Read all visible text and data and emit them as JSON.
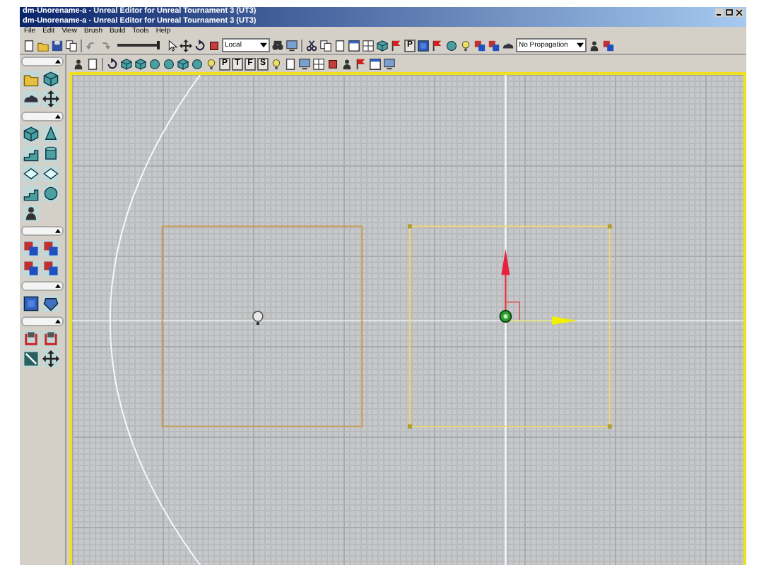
{
  "window": {
    "title": "dm-Unorename-a - Unreal Editor for Unreal Tournament 3 (UT3)",
    "subtitle": "dm-Unorename-a - Unreal Editor for Unreal Tournament 3 (UT3)"
  },
  "menu": [
    "File",
    "Edit",
    "View",
    "Brush",
    "Build",
    "Tools",
    "Help"
  ],
  "toolbar": {
    "slider": {
      "level": 0.95
    },
    "coordinate_dropdown": "Local",
    "letter_button": "P",
    "propagation_dropdown": "No Propagation"
  },
  "viewport_toolbar": {
    "view_buttons": [
      "P",
      "T",
      "F",
      "S"
    ]
  }
}
